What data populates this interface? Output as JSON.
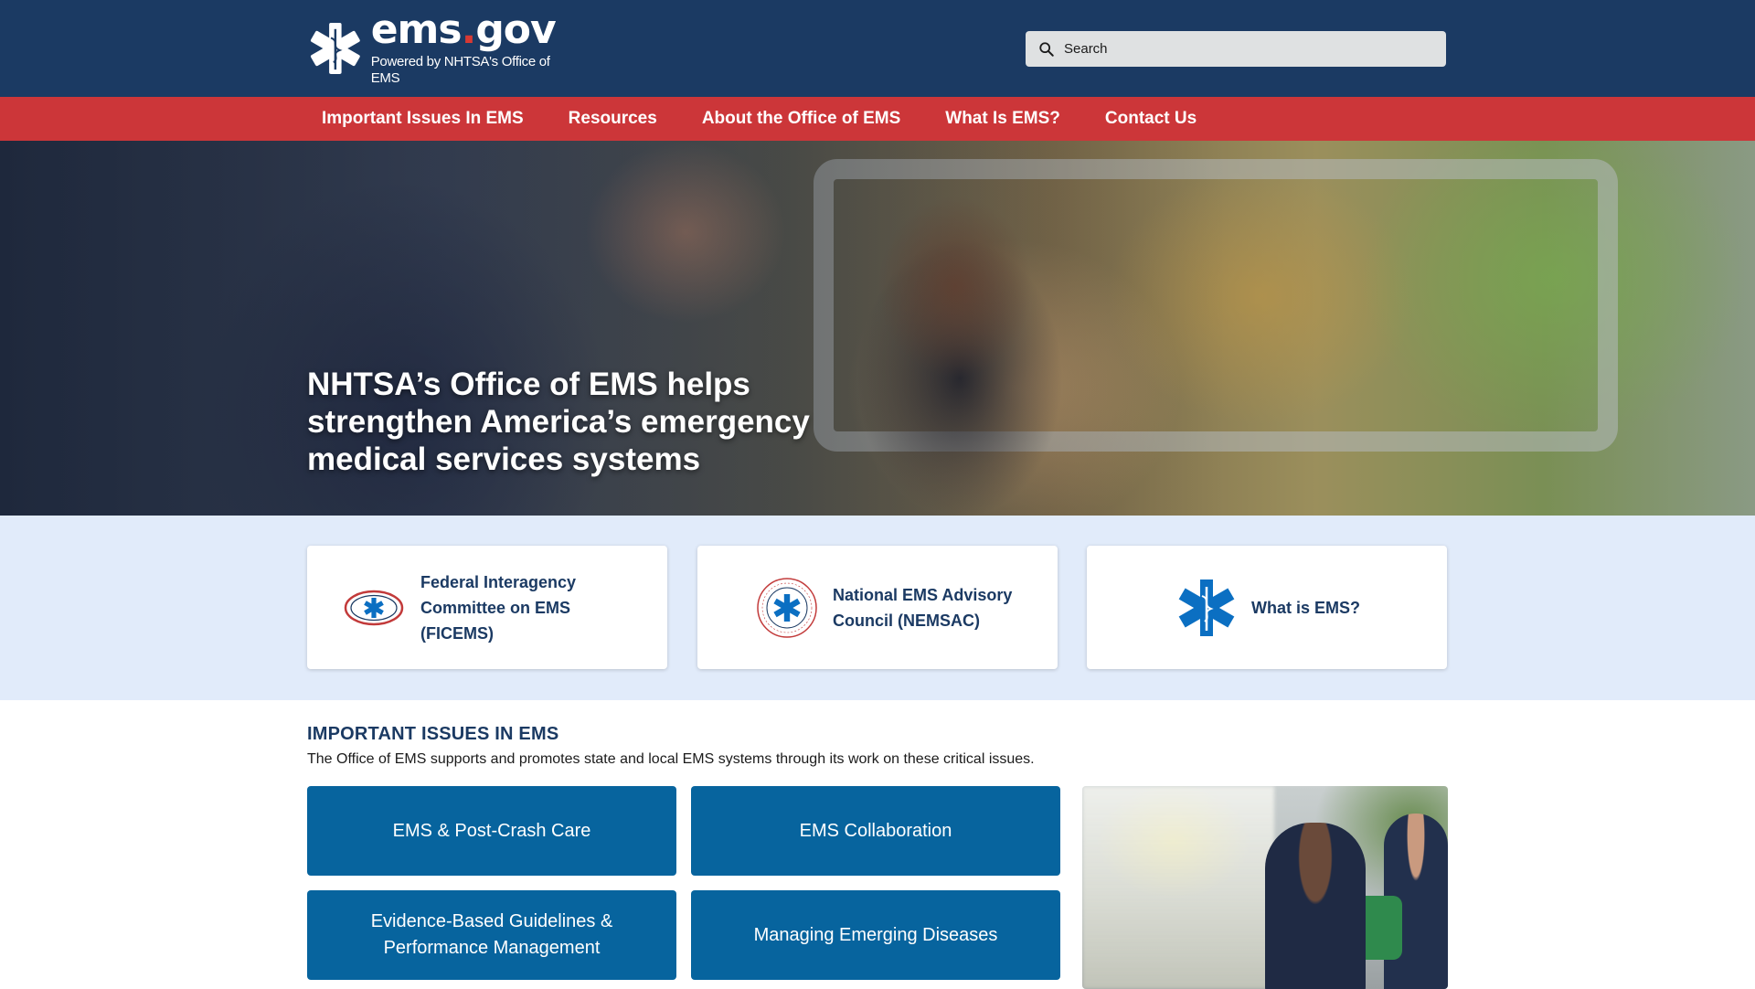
{
  "header": {
    "logo_main_a": "ems",
    "logo_main_dot": ".",
    "logo_main_b": "gov",
    "logo_sub": "Powered by NHTSA's Office of EMS",
    "search_placeholder": "Search"
  },
  "nav": {
    "items": [
      {
        "label": "Important Issues In EMS"
      },
      {
        "label": "Resources"
      },
      {
        "label": "About the Office of EMS"
      },
      {
        "label": "What Is EMS?"
      },
      {
        "label": "Contact Us"
      }
    ]
  },
  "hero": {
    "title": "NHTSA’s Office of EMS helps strengthen America’s emergency medical services systems"
  },
  "cards": [
    {
      "label": "Federal Interagency Committee on EMS (FICEMS)"
    },
    {
      "label": "National EMS Advisory Council (NEMSAC)"
    },
    {
      "label": "What is EMS?"
    }
  ],
  "issues": {
    "title": "IMPORTANT ISSUES IN EMS",
    "description": "The Office of EMS supports and promotes state and local EMS systems through its work on these critical issues.",
    "tiles": [
      {
        "label": "EMS & Post-Crash Care"
      },
      {
        "label": "EMS Collaboration"
      },
      {
        "label": "Evidence-Based Guidelines & Performance Management"
      },
      {
        "label": "Managing Emerging Diseases"
      }
    ]
  },
  "colors": {
    "header_bg": "#1b3a63",
    "nav_bg": "#cc3639",
    "band_bg": "#e1ebfa",
    "tile_bg": "#07649e",
    "star_blue": "#0b6fc2"
  }
}
